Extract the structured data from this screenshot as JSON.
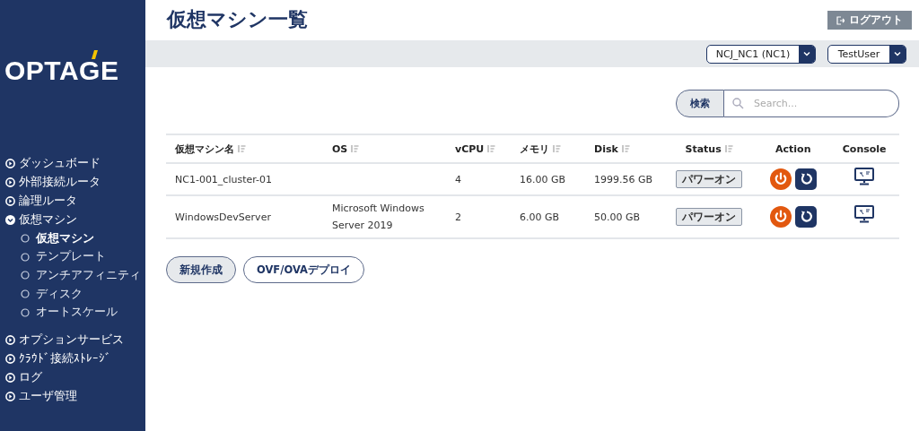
{
  "sidebar": {
    "logo": "OPTAGE",
    "items": [
      {
        "label": "ダッシュボード",
        "expanded": false
      },
      {
        "label": "外部接続ルータ",
        "expanded": false
      },
      {
        "label": "論理ルータ",
        "expanded": false
      },
      {
        "label": "仮想マシン",
        "expanded": true,
        "children": [
          {
            "label": "仮想マシン",
            "selected": true
          },
          {
            "label": "テンプレート",
            "selected": false
          },
          {
            "label": "アンチアフィニティ",
            "selected": false
          },
          {
            "label": "ディスク",
            "selected": false
          },
          {
            "label": "オートスケール",
            "selected": false
          }
        ]
      },
      {
        "label": "オプションサービス",
        "expanded": false
      },
      {
        "label": "ｸﾗｳﾄﾞ接続ｽﾄﾚｰｼﾞ",
        "expanded": false
      },
      {
        "label": "ログ",
        "expanded": false
      },
      {
        "label": "ユーザ管理",
        "expanded": false
      }
    ]
  },
  "header": {
    "title": "仮想マシン一覧",
    "logout": "ログアウト"
  },
  "toolbar": {
    "project": "NCJ_NC1 (NC1)",
    "user": "TestUser"
  },
  "search": {
    "button": "検索",
    "placeholder": "Search..."
  },
  "table": {
    "columns": [
      {
        "label": "仮想マシン名",
        "sortable": true
      },
      {
        "label": "OS",
        "sortable": true
      },
      {
        "label": "vCPU",
        "sortable": true
      },
      {
        "label": "メモリ",
        "sortable": true
      },
      {
        "label": "Disk",
        "sortable": true
      },
      {
        "label": "Status",
        "sortable": true
      },
      {
        "label": "Action",
        "sortable": false
      },
      {
        "label": "Console",
        "sortable": false
      }
    ],
    "rows": [
      {
        "name": "NC1-001_cluster-01",
        "os": "",
        "vcpu": "4",
        "memory": "16.00 GB",
        "disk": "1999.56 GB",
        "status": "パワーオン"
      },
      {
        "name": "WindowsDevServer",
        "os": "Microsoft Windows Server 2019",
        "vcpu": "2",
        "memory": "6.00 GB",
        "disk": "50.00 GB",
        "status": "パワーオン"
      }
    ]
  },
  "buttons": [
    {
      "label": "新規作成",
      "kind": "filled"
    },
    {
      "label": "OVF/OVAデプロイ",
      "kind": "outline"
    }
  ]
}
